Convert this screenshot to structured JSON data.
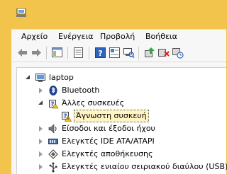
{
  "menu": {
    "items": [
      "Αρχείο",
      "Ενέργεια",
      "Προβολή",
      "Βοήθεια"
    ]
  },
  "toolbar": {
    "buttons": [
      "back-icon",
      "forward-icon",
      "show-hide-console-tree-icon",
      "properties-icon",
      "help-icon",
      "view-icon",
      "scan-hardware-icon",
      "update-driver-icon",
      "uninstall-icon",
      "disable-device-icon"
    ]
  },
  "tree": {
    "root": "laptop",
    "items": [
      "Bluetooth",
      "Άλλες συσκευές",
      "Άγνωστη συσκευή",
      "Είσοδοι και έξοδοι ήχου",
      "Ελεγκτές IDE ATA/ATAPI",
      "Ελεγκτές αποθήκευσης",
      "Ελεγκτές ενιαίου σειριακού διαύλου (USB)"
    ]
  },
  "colors": {
    "title_bg": "#f2c44c",
    "pane_bg": "#f7f7f7",
    "selection_bg": "#fff4c2"
  }
}
